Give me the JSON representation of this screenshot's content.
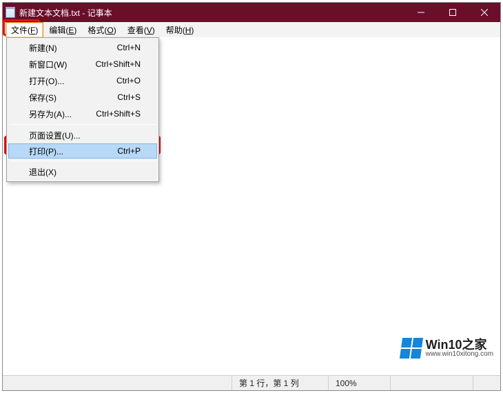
{
  "title": "新建文本文档.txt - 记事本",
  "menu": {
    "file": {
      "label": "文件(",
      "mn": "F",
      "tail": ")"
    },
    "edit": {
      "label": "编辑(",
      "mn": "E",
      "tail": ")"
    },
    "format": {
      "label": "格式(",
      "mn": "O",
      "tail": ")"
    },
    "view": {
      "label": "查看(",
      "mn": "V",
      "tail": ")"
    },
    "help": {
      "label": "帮助(",
      "mn": "H",
      "tail": ")"
    }
  },
  "fileMenu": {
    "new": {
      "label": "新建(N)",
      "short": "Ctrl+N"
    },
    "newWindow": {
      "label": "新窗口(W)",
      "short": "Ctrl+Shift+N"
    },
    "open": {
      "label": "打开(O)...",
      "short": "Ctrl+O"
    },
    "save": {
      "label": "保存(S)",
      "short": "Ctrl+S"
    },
    "saveAs": {
      "label": "另存为(A)...",
      "short": "Ctrl+Shift+S"
    },
    "pageSetup": {
      "label": "页面设置(U)...",
      "short": ""
    },
    "print": {
      "label": "打印(P)...",
      "short": "Ctrl+P"
    },
    "exit": {
      "label": "退出(X)",
      "short": ""
    }
  },
  "status": {
    "position": "第 1 行，第 1 列",
    "zoom": "100%"
  },
  "watermark": {
    "brand": "Win10之家",
    "url": "www.win10xitong.com"
  }
}
